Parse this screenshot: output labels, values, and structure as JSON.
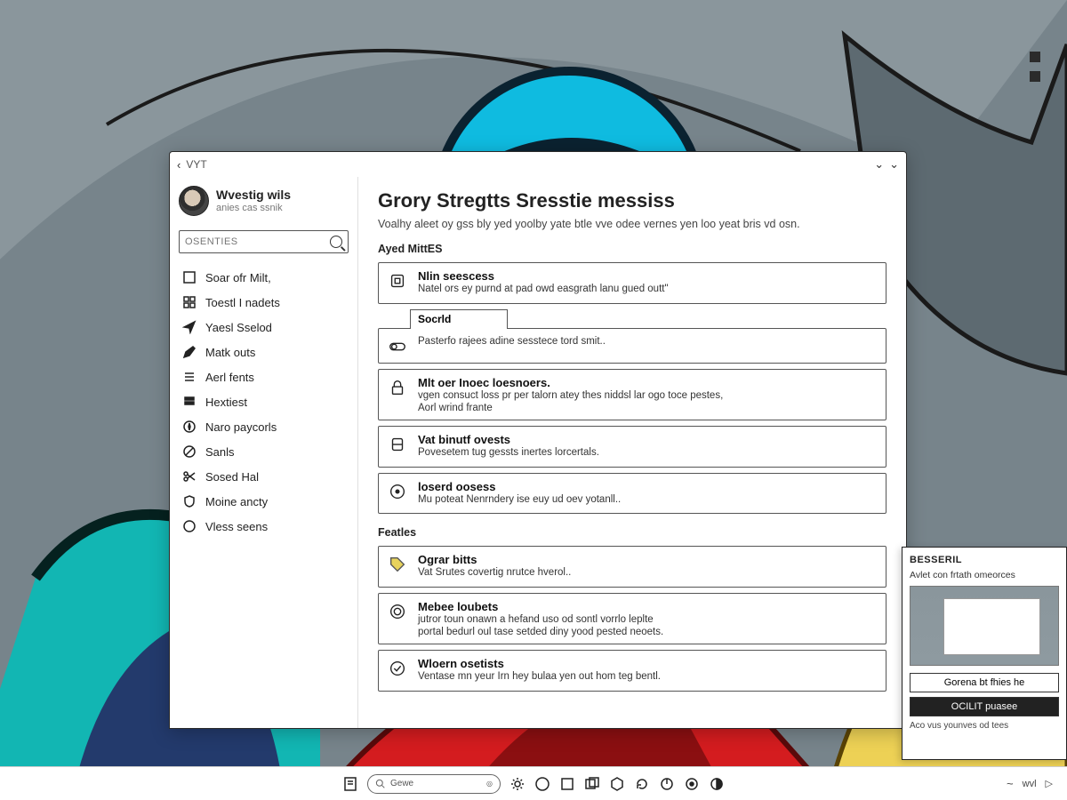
{
  "titlebar": {
    "label": "VYT"
  },
  "account": {
    "name": "Wvestig wils",
    "subtitle": "anies cas ssnik"
  },
  "search": {
    "placeholder": "OSENTIES"
  },
  "sidebar": {
    "items": [
      {
        "label": "Soar ofr Milt,"
      },
      {
        "label": "Toestl I nadets"
      },
      {
        "label": "Yaesl Sselod"
      },
      {
        "label": "Matk outs"
      },
      {
        "label": "Aerl fents"
      },
      {
        "label": "Hextiest"
      },
      {
        "label": "Naro paycorls"
      },
      {
        "label": "Sanls"
      },
      {
        "label": "Sosed Hal"
      },
      {
        "label": "Moine ancty"
      },
      {
        "label": "Vless seens"
      }
    ]
  },
  "page": {
    "title": "Grory Stregtts Sresstie messiss",
    "subtitle": "Voalhy aleet oy gss bly yed yoolby yate btle vve odee vernes yen loo yeat bris vd osn."
  },
  "section1": {
    "label": "Ayed MittES",
    "tab": "Socrld",
    "cards": [
      {
        "title": "Nlin seescess",
        "desc": "Natel ors ey purnd at pad owd easgrath lanu gued outt\""
      },
      {
        "title": "",
        "desc": "Pasterfo rajees adine sesstece tord smit.."
      },
      {
        "title": "Mlt oer Inoec loesnoers.",
        "desc": "vgen consuct loss pr per talorn atey thes niddsl lar ogo toce pestes,",
        "desc2": "Aorl wrind frante"
      },
      {
        "title": "Vat binutf ovests",
        "desc": "Povesetem tug gessts inertes lorcertals."
      },
      {
        "title": "loserd oosess",
        "desc": "Mu poteat Nenrndery ise euy ud oev yotanll.."
      }
    ]
  },
  "section2": {
    "label": "Featles",
    "cards": [
      {
        "title": "Ograr bitts",
        "desc": "Vat Srutes covertig nrutce hverol.."
      },
      {
        "title": "Mebee loubets",
        "desc": "jutror toun onawn a hefand uso od sontl vorrlo leplte",
        "desc2": "portal bedurl oul tase setded diny yood pested neoets."
      },
      {
        "title": "Wloern osetists",
        "desc": "Ventase mn yeur Irn hey bulaa yen out hom teg bentl."
      }
    ]
  },
  "popup": {
    "title": "BESSERIL",
    "subtitle": "Avlet con frtath omeorces",
    "button_light": "Gorena bt fhies he",
    "button_dark": "OCILIT puasee",
    "footer": "Aco vus younves od tees"
  },
  "taskbar": {
    "search_placeholder": "Gewe"
  },
  "tray": {
    "text": "wvl"
  }
}
